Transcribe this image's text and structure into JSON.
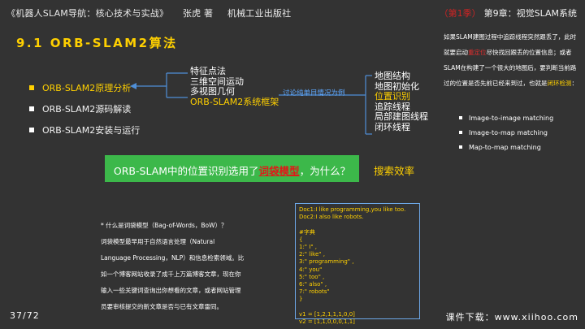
{
  "header": {
    "book_title": "《机器人SLAM导航：核心技术与实战》",
    "author": "张虎 著",
    "publisher": "机械工业出版社",
    "season": "（第1季）",
    "chapter": "第9章：视觉SLAM系统"
  },
  "section_title": "9.1  ORB-SLAM2算法",
  "left_bullets": [
    "ORB-SLAM2原理分析",
    "ORB-SLAM2源码解读",
    "ORB-SLAM2安装与运行"
  ],
  "mid_list": [
    "特征点法",
    "三维空间运动",
    "多视图几何",
    "ORB-SLAM2系统框架"
  ],
  "arrow_label": "讨论纯单目情况为例",
  "right_list": [
    "地图结构",
    "地图初始化",
    "位置识别",
    "追踪线程",
    "局部建图线程",
    "闭环线程"
  ],
  "side_panel": {
    "para_part1": "如果SLAM建图过程中追踪线程突然跟丢了，此时就要启动",
    "para_keyword1": "重定位",
    "para_part2": "尽快找回跟丢的位置信息；或者SLAM在构建了一个很大的地图后，要判断当前路过的位置是否先前已经来到过，也就是",
    "para_keyword2": "闭环检测",
    "para_part3": "：",
    "items": [
      "Image-to-image matching",
      "Image-to-map matching",
      "Map-to-map matching"
    ]
  },
  "question": {
    "part1": "ORB-SLAM中的位置识别选用了",
    "keyword": "词袋模型",
    "part2": "，为什么？"
  },
  "answer": "搜索效率",
  "bow_text": [
    "* 什么是词袋模型（Bag-of-Words，BoW）？",
    "词袋模型最早用于自然语言处理（Natural Language Processing，NLP）和信息检索领域。比如一个博客网站收录了成千上万篇博客文章，现在你输入一些关键词查询出你想看的文章，或者网站管理员要审核提交的新文章是否与已有文章雷同。"
  ],
  "code_lines": [
    "Doc1:I like programming,you like too.",
    "Doc2:I also like robots.",
    "",
    "#字典",
    "{",
    "1:\" I\" ,",
    "2:\" like\" ,",
    "3:\" programming\" ,",
    "4:\" you\"",
    "5:\" too\" ,",
    "6:\" also\" ,",
    "7:\" robots\"",
    "}",
    "",
    "v1 = [1,2,1,1,1,0,0]",
    "v2 = [1,1,0,0,0,1,1]"
  ],
  "page_number": "37/72",
  "footer": "课件下载：www.xiihoo.com",
  "colors": {
    "background": "#333333",
    "accent_yellow": "#ffd000",
    "highlight_red": "#e01818",
    "green_box": "#3cb84a",
    "link_blue": "#5ea8ff"
  }
}
